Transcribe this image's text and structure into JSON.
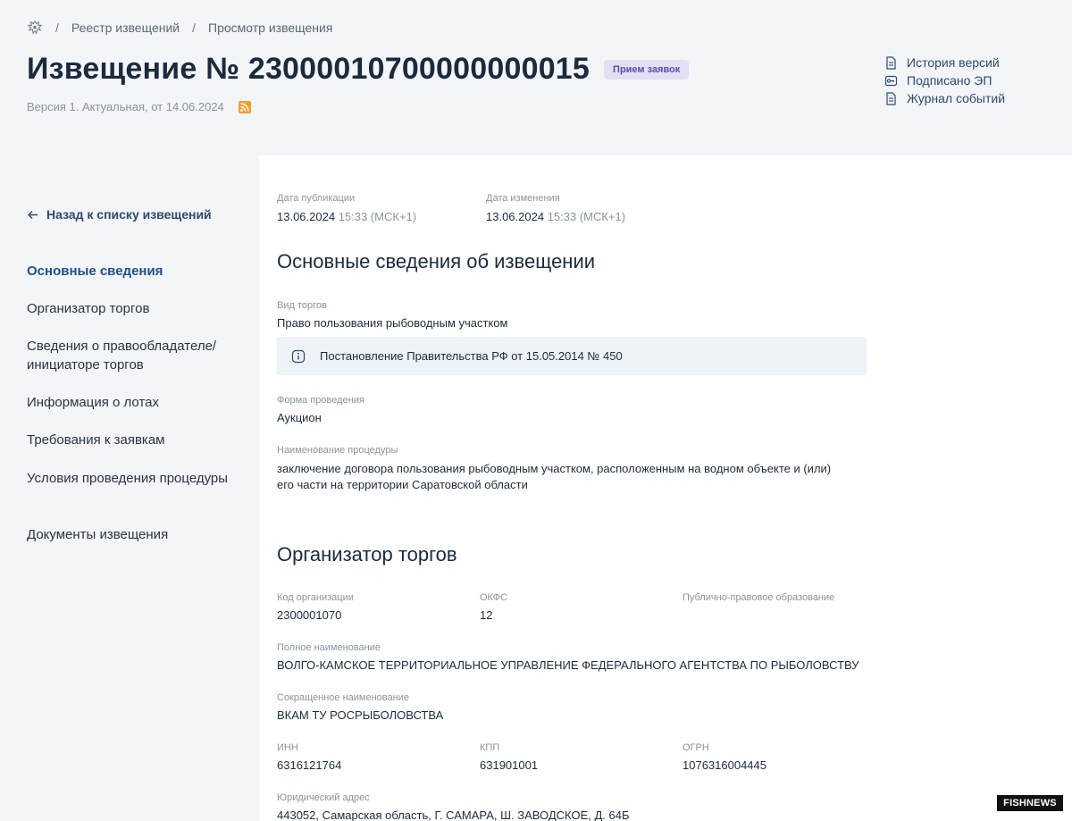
{
  "breadcrumb": {
    "items": [
      "Реестр извещений",
      "Просмотр извещения"
    ],
    "separator": "/"
  },
  "notice": {
    "title": "Извещение № 23000010700000000015",
    "status": "Прием заявок",
    "version": "Версия 1. Актуальная, от 14.06.2024"
  },
  "side_links": [
    "История версий",
    "Подписано ЭП",
    "Журнал событий"
  ],
  "sidebar": {
    "back": "Назад к списку извещений",
    "items": [
      "Основные сведения",
      "Организатор торгов",
      "Сведения о правообладателе/ инициаторе торгов",
      "Информация о лотах",
      "Требования к заявкам",
      "Условия проведения процедуры",
      "Документы извещения"
    ]
  },
  "dates": {
    "published_label": "Дата публикации",
    "published_date": "13.06.2024",
    "published_time": "15:33 (МСК+1)",
    "changed_label": "Дата изменения",
    "changed_date": "13.06.2024",
    "changed_time": "15:33 (МСК+1)"
  },
  "basic": {
    "title": "Основные сведения об извещении",
    "type_label": "Вид торгов",
    "type_value": "Право пользования рыбоводным участком",
    "info": "Постановление Правительства РФ от 15.05.2014 № 450",
    "form_label": "Форма проведения",
    "form_value": "Аукцион",
    "name_label": "Наименование процедуры",
    "name_value": "заключение договора пользования рыбоводным участком, расположенным на водном объекте и (или) его части на территории Саратовской области"
  },
  "organizer": {
    "title": "Организатор торгов",
    "code_label": "Код организации",
    "code_value": "2300001070",
    "okfs_label": "ОКФС",
    "okfs_value": "12",
    "ppo_label": "Публично-правовое образование",
    "full_label": "Полное наименование",
    "full_value": "ВОЛГО-КАМСКОЕ ТЕРРИТОРИАЛЬНОЕ УПРАВЛЕНИЕ ФЕДЕРАЛЬНОГО АГЕНТСТВА ПО РЫБОЛОВСТВУ",
    "short_label": "Сокращенное наименование",
    "short_value": "ВКАМ ТУ РОСРЫБОЛОВСТВА",
    "inn_label": "ИНН",
    "inn_value": "6316121764",
    "kpp_label": "КПП",
    "kpp_value": "631901001",
    "ogrn_label": "ОГРН",
    "ogrn_value": "1076316004445",
    "address_label": "Юридический адрес",
    "address_value": "443052, Самарская область, Г. САМАРА, Ш. ЗАВОДСКОЕ, Д. 64Б"
  },
  "watermark": {
    "a": "FISH",
    "b": "NEWS"
  }
}
